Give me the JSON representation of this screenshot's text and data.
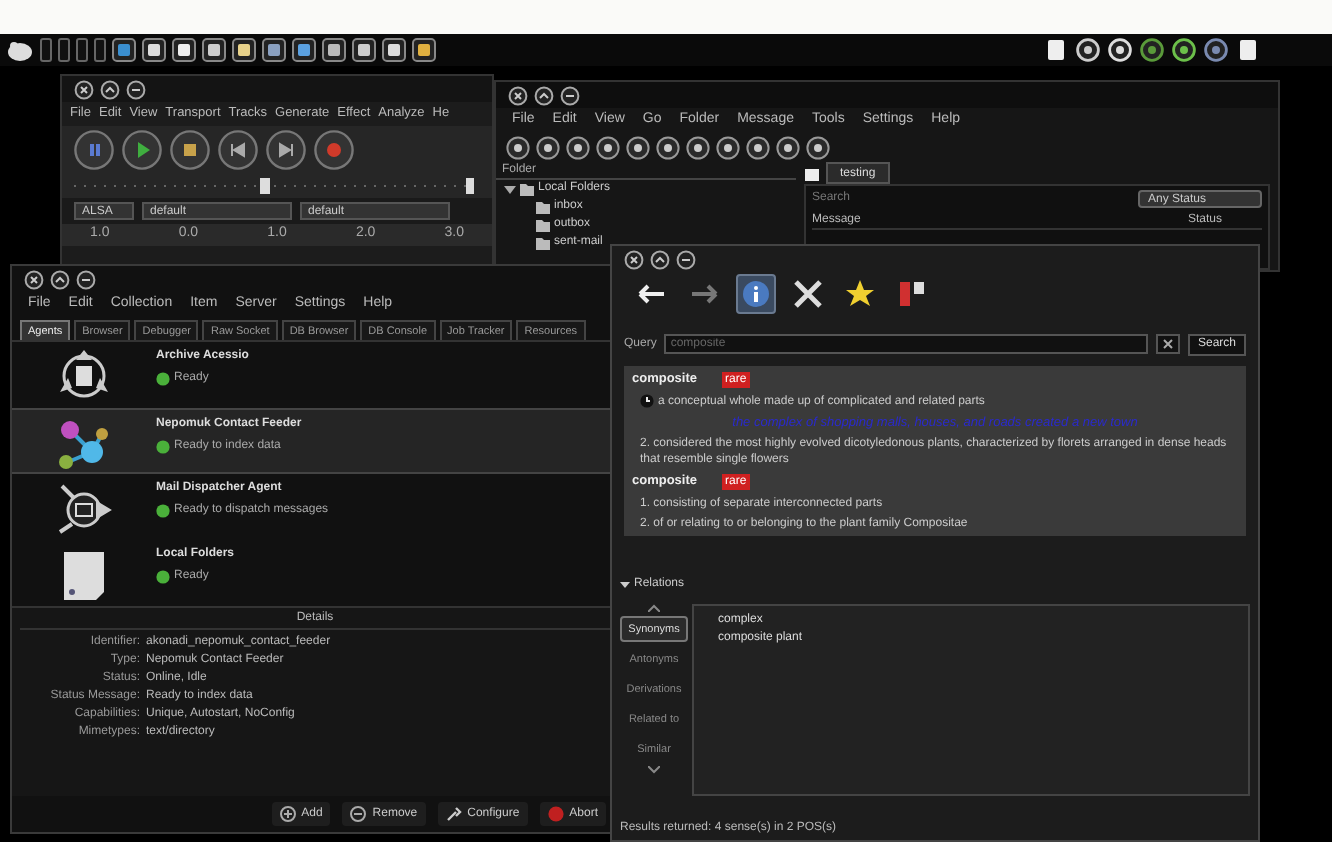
{
  "audio_window": {
    "menu": [
      "File",
      "Edit",
      "View",
      "Transport",
      "Tracks",
      "Generate",
      "Effect",
      "Analyze",
      "He"
    ],
    "host": "ALSA",
    "devices": [
      "default",
      "default"
    ],
    "ruler": [
      "1.0",
      "0.0",
      "1.0",
      "2.0",
      "3.0"
    ]
  },
  "mail_window": {
    "menu": [
      "File",
      "Edit",
      "View",
      "Go",
      "Folder",
      "Message",
      "Tools",
      "Settings",
      "Help"
    ],
    "folder_label": "Folder",
    "tree": [
      {
        "label": "Local Folders",
        "expanded": true,
        "children": [
          {
            "label": "inbox"
          },
          {
            "label": "outbox"
          },
          {
            "label": "sent-mail"
          }
        ]
      }
    ],
    "tab": "testing",
    "search_placeholder": "Search",
    "status_filter": "Any Status",
    "columns": [
      "Message",
      "Status"
    ]
  },
  "akonadi_window": {
    "menu": [
      "File",
      "Edit",
      "Collection",
      "Item",
      "Server",
      "Settings",
      "Help"
    ],
    "tabs": [
      {
        "label": "Agents",
        "selected": true
      },
      {
        "label": "Browser",
        "selected": false
      },
      {
        "label": "Debugger",
        "selected": false
      },
      {
        "label": "Raw Socket",
        "selected": false
      },
      {
        "label": "DB Browser",
        "selected": false
      },
      {
        "label": "DB Console",
        "selected": false
      },
      {
        "label": "Job Tracker",
        "selected": false
      },
      {
        "label": "Resources",
        "selected": false
      }
    ],
    "agents": [
      {
        "kind": "archive",
        "name": "Archive Acessio",
        "status": "Ready",
        "selected": false
      },
      {
        "kind": "feeder",
        "name": "Nepomuk Contact Feeder",
        "status": "Ready to index data",
        "selected": true
      },
      {
        "kind": "mail",
        "name": "Mail Dispatcher Agent",
        "status": "Ready to dispatch messages",
        "selected": false
      },
      {
        "kind": "folder",
        "name": "Local Folders",
        "status": "Ready",
        "selected": false
      }
    ],
    "details": {
      "title": "Details",
      "fields": [
        {
          "label": "Identifier:",
          "value": "akonadi_nepomuk_contact_feeder"
        },
        {
          "label": "Type:",
          "value": "Nepomuk Contact Feeder"
        },
        {
          "label": "Status:",
          "value": "Online, Idle"
        },
        {
          "label": "Status Message:",
          "value": "Ready to index data"
        },
        {
          "label": "Capabilities:",
          "value": "Unique, Autostart, NoConfig"
        },
        {
          "label": "Mimetypes:",
          "value": "text/directory"
        }
      ]
    },
    "buttons": [
      {
        "kind": "add",
        "label": "Add"
      },
      {
        "kind": "remove",
        "label": "Remove"
      },
      {
        "kind": "configure",
        "label": "Configure"
      },
      {
        "kind": "abort",
        "label": "Abort"
      }
    ]
  },
  "dictionary_window": {
    "toolbar": [
      {
        "kind": "back",
        "selected": false
      },
      {
        "kind": "forward",
        "selected": false
      },
      {
        "kind": "info",
        "selected": true
      },
      {
        "kind": "tools",
        "selected": false
      },
      {
        "kind": "star",
        "selected": false
      },
      {
        "kind": "flags",
        "selected": false
      }
    ],
    "query_label": "Query",
    "query_placeholder": "composite",
    "search_button": "Search",
    "entries": [
      {
        "word": "composite",
        "tag": "rare",
        "senses": [
          {
            "marker": true,
            "text": "a conceptual whole made up of complicated and related parts",
            "example": "the complex of shopping malls, houses, and roads created a new town"
          },
          {
            "marker": false,
            "text": "2. considered the most highly evolved dicotyledonous plants, characterized by florets arranged in dense heads that resemble single flowers"
          }
        ]
      },
      {
        "word": "composite",
        "tag": "rare",
        "senses": [
          {
            "marker": false,
            "text": "1. consisting of separate interconnected parts"
          },
          {
            "marker": false,
            "text": "2. of or relating to or belonging to the plant family Compositae"
          }
        ]
      }
    ],
    "relations": {
      "title": "Relations",
      "tabs": [
        {
          "label": "Synonyms",
          "selected": true
        },
        {
          "label": "Antonyms",
          "selected": false
        },
        {
          "label": "Derivations",
          "selected": false
        },
        {
          "label": "Related to",
          "selected": false
        },
        {
          "label": "Similar",
          "selected": false
        }
      ],
      "items": [
        "complex",
        "composite plant"
      ]
    },
    "status": "Results returned: 4 sense(s) in 2 POS(s)"
  }
}
